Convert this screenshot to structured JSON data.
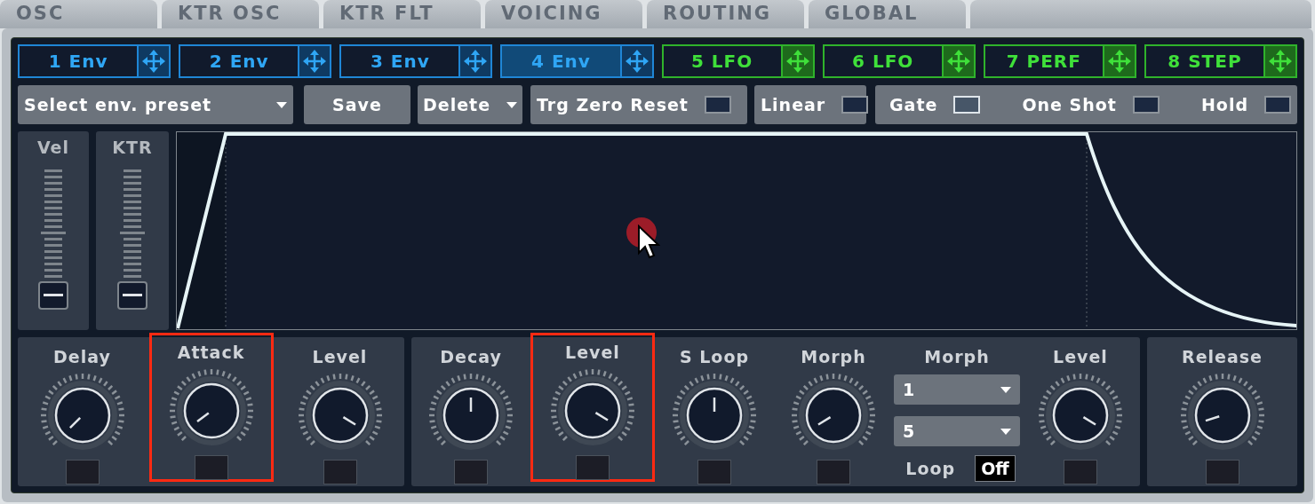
{
  "tabs": [
    {
      "label": "OSC",
      "selected": false
    },
    {
      "label": "KTR OSC",
      "selected": false
    },
    {
      "label": "KTR FLT",
      "selected": false
    },
    {
      "label": "VOICING",
      "selected": false
    },
    {
      "label": "ROUTING",
      "selected": false
    },
    {
      "label": "GLOBAL",
      "selected": false
    }
  ],
  "slots": [
    {
      "label": "1 Env",
      "kind": "env",
      "selected": false
    },
    {
      "label": "2 Env",
      "kind": "env",
      "selected": false
    },
    {
      "label": "3 Env",
      "kind": "env",
      "selected": false
    },
    {
      "label": "4 Env",
      "kind": "env",
      "selected": true
    },
    {
      "label": "5 LFO",
      "kind": "lfo",
      "selected": false
    },
    {
      "label": "6 LFO",
      "kind": "lfo",
      "selected": false
    },
    {
      "label": "7 PERF",
      "kind": "lfo",
      "selected": false
    },
    {
      "label": "8 STEP",
      "kind": "lfo",
      "selected": false
    }
  ],
  "preset_dropdown": "Select env. preset",
  "save_button": "Save",
  "delete_button": "Delete",
  "toggle_groups": [
    {
      "toggles": [
        {
          "label": "Trg Zero Reset",
          "checked": false
        }
      ]
    },
    {
      "toggles": [
        {
          "label": "Linear",
          "checked": false
        }
      ]
    },
    {
      "toggles": [
        {
          "label": "Gate",
          "checked": true
        },
        {
          "label": "One Shot",
          "checked": false
        },
        {
          "label": "Hold",
          "checked": false
        }
      ]
    }
  ],
  "sliders": [
    {
      "label": "Vel"
    },
    {
      "label": "KTR"
    }
  ],
  "knob_groups": [
    {
      "controls": [
        {
          "kind": "knob",
          "label": "Delay",
          "highlighted": false
        },
        {
          "kind": "knob",
          "label": "Attack",
          "highlighted": true
        },
        {
          "kind": "knob",
          "label": "Level",
          "highlighted": false
        }
      ]
    },
    {
      "controls": [
        {
          "kind": "knob",
          "label": "Decay",
          "highlighted": false
        },
        {
          "kind": "knob",
          "label": "Level",
          "highlighted": true
        },
        {
          "kind": "knob",
          "label": "S Loop",
          "highlighted": false
        },
        {
          "kind": "knob",
          "label": "Morph",
          "highlighted": false
        },
        {
          "kind": "morph",
          "label": "Morph",
          "dropdowns": [
            "1",
            "5"
          ],
          "loop_label": "Loop",
          "loop_value": "Off"
        },
        {
          "kind": "knob",
          "label": "Level",
          "highlighted": false
        }
      ]
    },
    {
      "controls": [
        {
          "kind": "knob",
          "label": "Release",
          "highlighted": false
        }
      ]
    }
  ]
}
